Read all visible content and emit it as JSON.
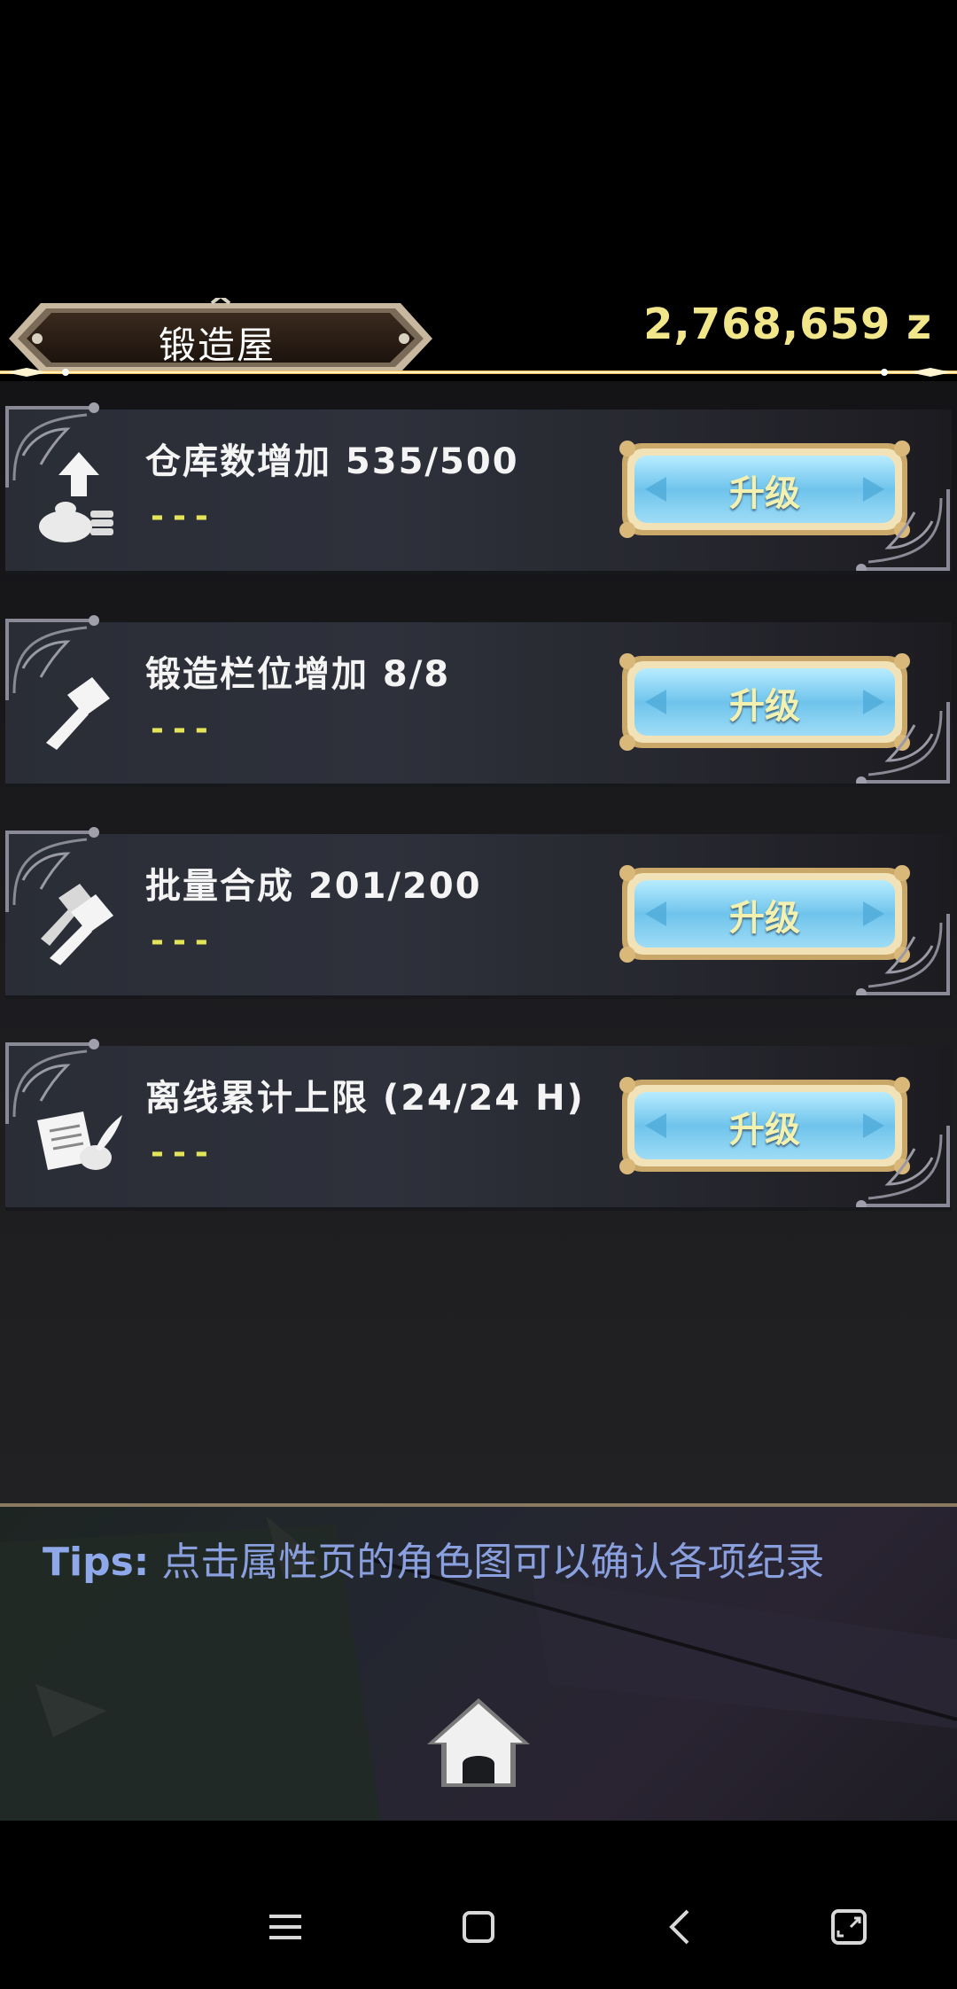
{
  "header": {
    "title": "锻造屋",
    "currency": "2,768,659 z"
  },
  "upgrades": [
    {
      "title": "仓库数增加 535/500",
      "sub": "---",
      "button": "升级",
      "icon": "money-bag-upload-icon"
    },
    {
      "title": "锻造栏位增加 8/8",
      "sub": "---",
      "button": "升级",
      "icon": "hammer-icon"
    },
    {
      "title": "批量合成 201/200",
      "sub": "---",
      "button": "升级",
      "icon": "double-hammer-icon"
    },
    {
      "title": "离线累计上限 (24/24 H)",
      "sub": "---",
      "button": "升级",
      "icon": "scroll-quill-icon"
    }
  ],
  "tips": {
    "label": "Tips:",
    "text": "点击属性页的角色图可以确认各项纪录"
  },
  "colors": {
    "accent_gold": "#f2e68a",
    "sub_yellow": "#e4e45a",
    "tips_blue": "#8aa0de",
    "button_blue": "#7ccbee"
  }
}
